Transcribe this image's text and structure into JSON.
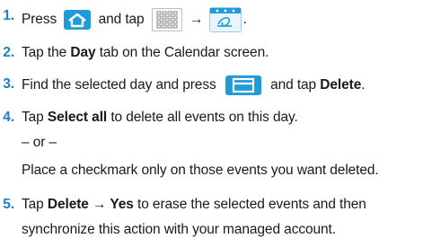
{
  "steps": [
    {
      "num": "1.",
      "part1": "Press",
      "part2": "and tap",
      "arrow": "→",
      "end": "."
    },
    {
      "num": "2.",
      "part1": "Tap the ",
      "bold1": "Day",
      "part2": " tab on the Calendar screen."
    },
    {
      "num": "3.",
      "part1": "Find the selected day and press",
      "part2": "and tap ",
      "bold1": "Delete",
      "end": "."
    },
    {
      "num": "4.",
      "part1": "Tap ",
      "bold1": "Select all",
      "part2": " to delete all events on this day.",
      "or": "– or –",
      "alt": "Place a checkmark only on those events you want deleted."
    },
    {
      "num": "5.",
      "part1": "Tap ",
      "bold1": "Delete → Yes",
      "part2": " to erase the selected events and then",
      "line2": "synchronize this action with your managed account."
    }
  ],
  "icons": {
    "home": "home-key",
    "apps": "applications-grid",
    "calendar": "calendar-app",
    "menu": "menu-key"
  },
  "colors": {
    "accent": "#1f7fbf",
    "key_blue": "#1f9bd8"
  }
}
